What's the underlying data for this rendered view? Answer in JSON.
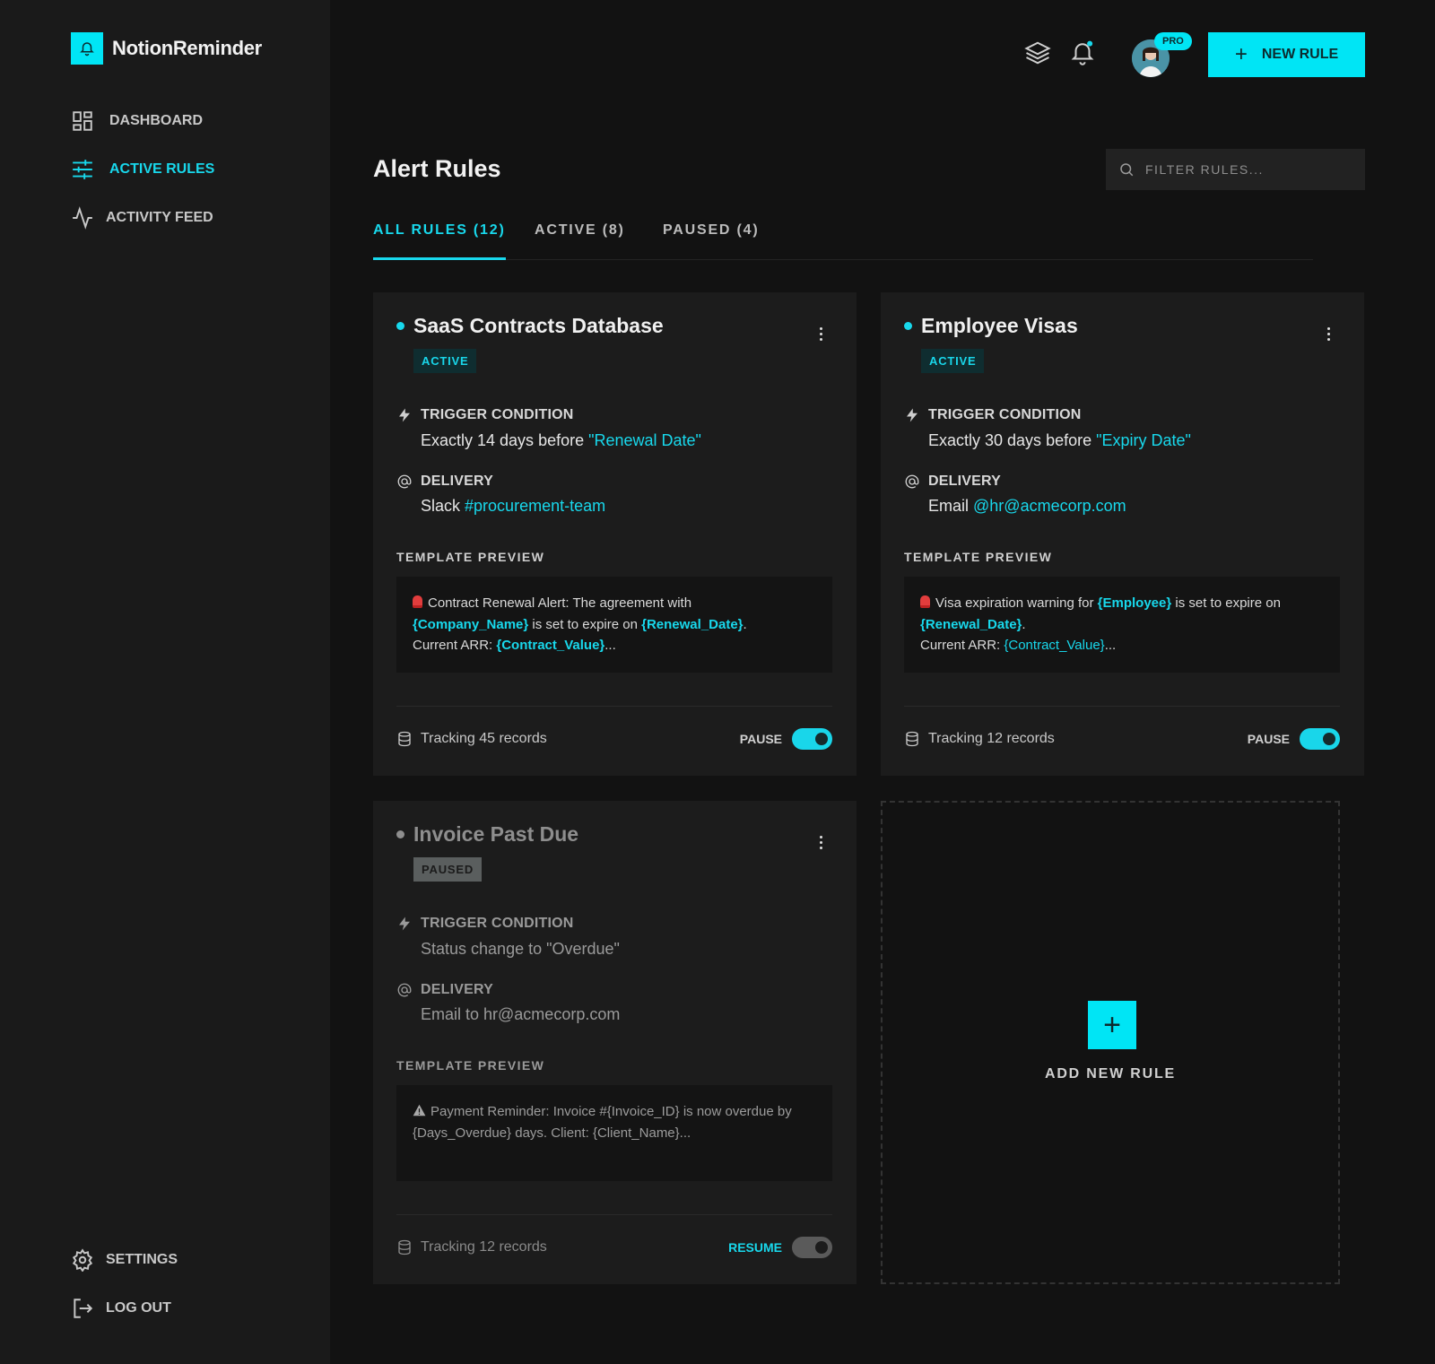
{
  "brand": {
    "name": "NotionReminder"
  },
  "nav": {
    "dashboard": "DASHBOARD",
    "active_rules": "ACTIVE RULES",
    "activity_feed": "ACTIVITY FEED",
    "settings": "SETTINGS",
    "logout": "LOG OUT"
  },
  "topbar": {
    "pro_badge": "PRO",
    "new_rule": "NEW RULE"
  },
  "page": {
    "title": "Alert Rules",
    "filter_placeholder": "FILTER RULES..."
  },
  "tabs": {
    "all": "ALL RULES (12)",
    "active": "ACTIVE (8)",
    "paused": "PAUSED (4)"
  },
  "labels": {
    "trigger": "TRIGGER CONDITION",
    "delivery": "DELIVERY",
    "template_preview": "TEMPLATE PREVIEW"
  },
  "cards": [
    {
      "title": "SaaS Contracts Database",
      "status": "ACTIVE",
      "trigger_text": "Exactly 14 days before ",
      "trigger_hl": "\"Renewal Date\"",
      "delivery_text": "Slack ",
      "delivery_hl": "#procurement-team",
      "tp": {
        "a": "Contract Renewal Alert: The agreement with",
        "v1": "{Company_Name}",
        "b": " is set to expire on ",
        "v2": "{Renewal_Date}",
        "c": ".",
        "d": "Current ARR: ",
        "v3": "{Contract_Value}",
        "e": "..."
      },
      "tracking": "Tracking 45 records",
      "toggle_label": "PAUSE"
    },
    {
      "title": "Employee Visas",
      "status": "ACTIVE",
      "trigger_text": "Exactly 30 days before ",
      "trigger_hl": "\"Expiry Date\"",
      "delivery_text": "Email ",
      "delivery_hl": "@hr@acmecorp.com",
      "tp": {
        "a": "Visa expiration warning for ",
        "v1": "{Employee}",
        "b": " is set to expire on",
        "v2": "{Renewal_Date}",
        "c": ".",
        "d": "Current ARR: ",
        "v3": "{Contract_Value}",
        "e": "..."
      },
      "tracking": "Tracking 12 records",
      "toggle_label": "PAUSE"
    },
    {
      "title": "Invoice Past Due",
      "status": "PAUSED",
      "trigger_text": "Status change to \"Overdue\"",
      "delivery_text": "Email to hr@acmecorp.com",
      "tp_text": "Payment Reminder: Invoice #{Invoice_ID} is now overdue by {Days_Overdue} days. Client: {Client_Name}...",
      "tracking": "Tracking 12 records",
      "toggle_label": "RESUME"
    }
  ],
  "add_card": {
    "label": "ADD NEW RULE"
  },
  "colors": {
    "accent": "#00e5f5",
    "background": "#121212",
    "sidebar": "#1a1a1a",
    "card": "#1c1c1c"
  },
  "icons": [
    "bell-logo-icon",
    "dashboard-icon",
    "sliders-icon",
    "activity-icon",
    "layers-icon",
    "bell-icon",
    "search-icon",
    "lightning-icon",
    "at-icon",
    "database-icon",
    "gear-icon",
    "logout-icon",
    "kebab-icon",
    "plus-icon",
    "siren-icon",
    "warning-icon"
  ]
}
